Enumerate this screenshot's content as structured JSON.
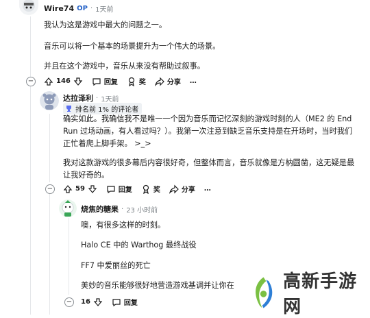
{
  "comment1": {
    "username": "Wire74",
    "op_badge": "OP",
    "time": "1天前",
    "paragraphs": [
      "我认为这是游戏中最大的问题之一。",
      "音乐可以将一个基本的场景提升为一个伟大的场景。",
      "并且在这个游戏中，音乐从来没有帮助过叙事。"
    ],
    "actions": {
      "votes": "146",
      "reply": "回复",
      "award": "奖",
      "share": "分享",
      "more": "…"
    }
  },
  "comment2": {
    "username": "达拉泽利",
    "time": "1天前",
    "flair": "排名前 1% 的评论者",
    "paragraphs": [
      "确实如此。我确信我不是唯一一个因为音乐而记忆深刻的游戏时刻的人（ME2 的 End",
      "Run 过场动画，有人看过吗？）。我第一次注意到缺乏音乐支持是在开场时，当时我们",
      "正忙着爬上脚手架。 >_>",
      "我对这款游戏的很多幕后内容很好奇，但整体而言，音乐就像是方枘圆凿，这无疑是最",
      "让我好奇的。"
    ],
    "actions": {
      "votes": "59",
      "reply": "回复",
      "award": "奖",
      "share": "分享",
      "more": "…"
    }
  },
  "comment3": {
    "username": "烧焦的糖果",
    "time": "23 小时前",
    "paragraphs": [
      "噢，有很多这样的时刻。",
      "Halo CE 中的 Warthog 最终战役",
      "FF7 中爱丽丝的死亡",
      "美妙的音乐能够很好地营造游戏基调并让你在"
    ],
    "actions": {
      "votes": "16",
      "reply": "回复"
    }
  },
  "watermark": {
    "text": "高新手游网"
  },
  "colors": {
    "op_blue": "#2a66c9",
    "line": "#e5e7ea",
    "watermark_green": "#7bc043",
    "watermark_blue": "#2e7fd6"
  }
}
